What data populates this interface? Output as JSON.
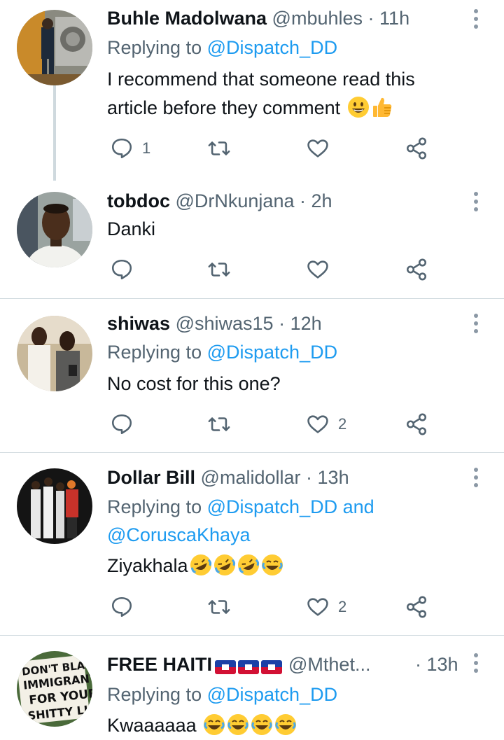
{
  "tweets": [
    {
      "name": "Buhle Madolwana",
      "handle": "@mbuhles",
      "time": "11h",
      "replying_prefix": "Replying to",
      "replying_to": "@Dispatch_DD",
      "text_lines": [
        "I recommend that someone read this",
        "article  before they comment"
      ],
      "emojis": [
        "grinning-face",
        "thumbs-up"
      ],
      "reply_count": "1",
      "like_count": ""
    },
    {
      "name": "tobdoc",
      "handle": "@DrNkunjana",
      "time": "2h",
      "text_lines": [
        "Danki"
      ],
      "reply_count": "",
      "like_count": ""
    },
    {
      "name": "shiwas",
      "handle": "@shiwas15",
      "time": "12h",
      "replying_prefix": "Replying to",
      "replying_to": "@Dispatch_DD",
      "text_lines": [
        "No cost for this one?"
      ],
      "reply_count": "",
      "like_count": "2"
    },
    {
      "name": "Dollar Bill",
      "handle": "@malidollar",
      "time": "13h",
      "replying_prefix": "Replying to",
      "replying_to": "@Dispatch_DD",
      "replying_and": "and",
      "replying_to_2": "@CoruscaKhaya",
      "text_lines": [
        "Ziyakhala"
      ],
      "emojis": [
        "rolling-laughing-face",
        "rolling-laughing-face",
        "rolling-laughing-face",
        "tears-of-joy-face"
      ],
      "reply_count": "",
      "like_count": "2"
    },
    {
      "name": "FREE HAITI",
      "name_flags": [
        "haiti-flag",
        "haiti-flag",
        "haiti-flag"
      ],
      "handle": "@Mthet...",
      "time": "13h",
      "replying_prefix": "Replying to",
      "replying_to": "@Dispatch_DD",
      "text_lines": [
        "Kwaaaaaa"
      ],
      "emojis": [
        "tears-of-joy-face",
        "tears-of-joy-face",
        "tears-of-joy-face",
        "tears-of-joy-face"
      ],
      "avatar_sign_lines": [
        "DON'T BLAME",
        "IMMIGRANTS",
        "FOR YOUR",
        "SHITTY LIFE"
      ]
    }
  ],
  "separator": "·",
  "colors": {
    "primary_text": "#0f1419",
    "secondary_text": "#536471",
    "link": "#1d9bf0",
    "divider": "#cfd9de",
    "icon": "#536471"
  }
}
